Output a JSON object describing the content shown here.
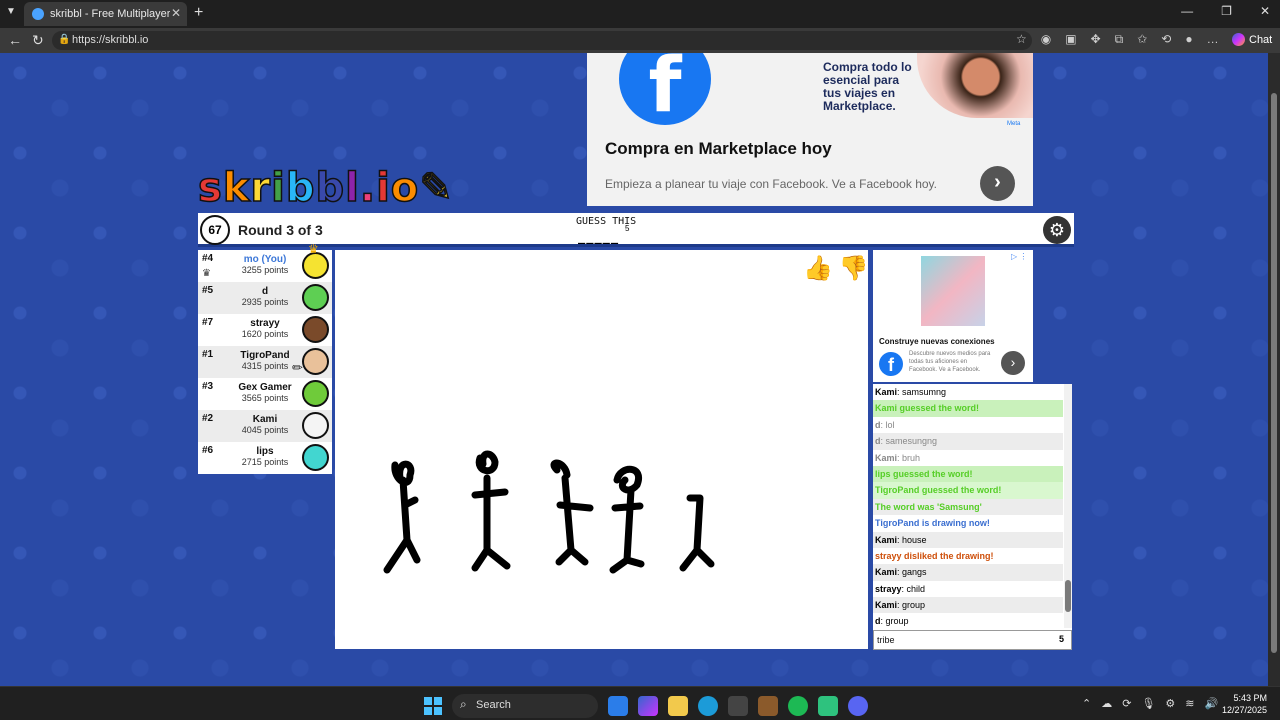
{
  "browser": {
    "tab_title": "skribbl - Free Multiplayer Drawing",
    "url": "https://skribbl.io",
    "chat_label": "Chat"
  },
  "ad_top": {
    "tagline": "Compra todo lo esencial para tus viajes en Marketplace.",
    "badge": "Meta",
    "headline": "Compra en Marketplace hoy",
    "subtext": "Empieza a planear tu viaje con Facebook. Ve a Facebook hoy."
  },
  "game": {
    "logo": "skribbl.io",
    "timer": "67",
    "round": "Round 3 of 3",
    "guess_label": "GUESS THIS",
    "hint": "_____",
    "hint_length": "5"
  },
  "players": [
    {
      "rank": "#4",
      "name": "mo (You)",
      "points": "3255 points",
      "you": true,
      "color": "#f5e331"
    },
    {
      "rank": "#5",
      "name": "d",
      "points": "2935 points",
      "color": "#5ecf53"
    },
    {
      "rank": "#7",
      "name": "strayy",
      "points": "1620 points",
      "color": "#7a4a2a"
    },
    {
      "rank": "#1",
      "name": "TigroPand",
      "points": "4315 points",
      "color": "#e9c19a"
    },
    {
      "rank": "#3",
      "name": "Gex Gamer",
      "points": "3565 points",
      "color": "#6fcb3a"
    },
    {
      "rank": "#2",
      "name": "Kami",
      "points": "4045 points",
      "color": "#f4f4f4"
    },
    {
      "rank": "#6",
      "name": "lips",
      "points": "2715 points",
      "color": "#42d6d0"
    }
  ],
  "ad_side": {
    "title": "Construye nuevas conexiones",
    "subtext": "Descubre nuevos medios para todas tus aficiones en Facebook. Ve a Facebook."
  },
  "chat": [
    {
      "user": "Kami",
      "text": "samsumng",
      "style": "plain"
    },
    {
      "text": "Kami guessed the word!",
      "style": "green"
    },
    {
      "user": "d",
      "text": "lol",
      "style": "grey"
    },
    {
      "user": "d",
      "text": "samesungng",
      "style": "grey"
    },
    {
      "user": "Kami",
      "text": "bruh",
      "style": "grey"
    },
    {
      "text": "lips guessed the word!",
      "style": "green"
    },
    {
      "text": "TigroPand guessed the word!",
      "style": "green"
    },
    {
      "text": "The word was 'Samsung'",
      "style": "greenlt"
    },
    {
      "text": "TigroPand is drawing now!",
      "style": "blue"
    },
    {
      "user": "Kami",
      "text": "house",
      "style": "plain"
    },
    {
      "text": "strayy disliked the drawing!",
      "style": "red"
    },
    {
      "user": "Kami",
      "text": "gangs",
      "style": "plain"
    },
    {
      "user": "strayy",
      "text": "child",
      "style": "plain"
    },
    {
      "user": "Kami",
      "text": "group",
      "style": "plain"
    },
    {
      "user": "d",
      "text": "group",
      "style": "plain"
    }
  ],
  "chat_input": {
    "value": "tribe",
    "count": "5"
  },
  "taskbar": {
    "search_label": "Search",
    "time": "5:43 PM",
    "date": "12/27/2025"
  }
}
